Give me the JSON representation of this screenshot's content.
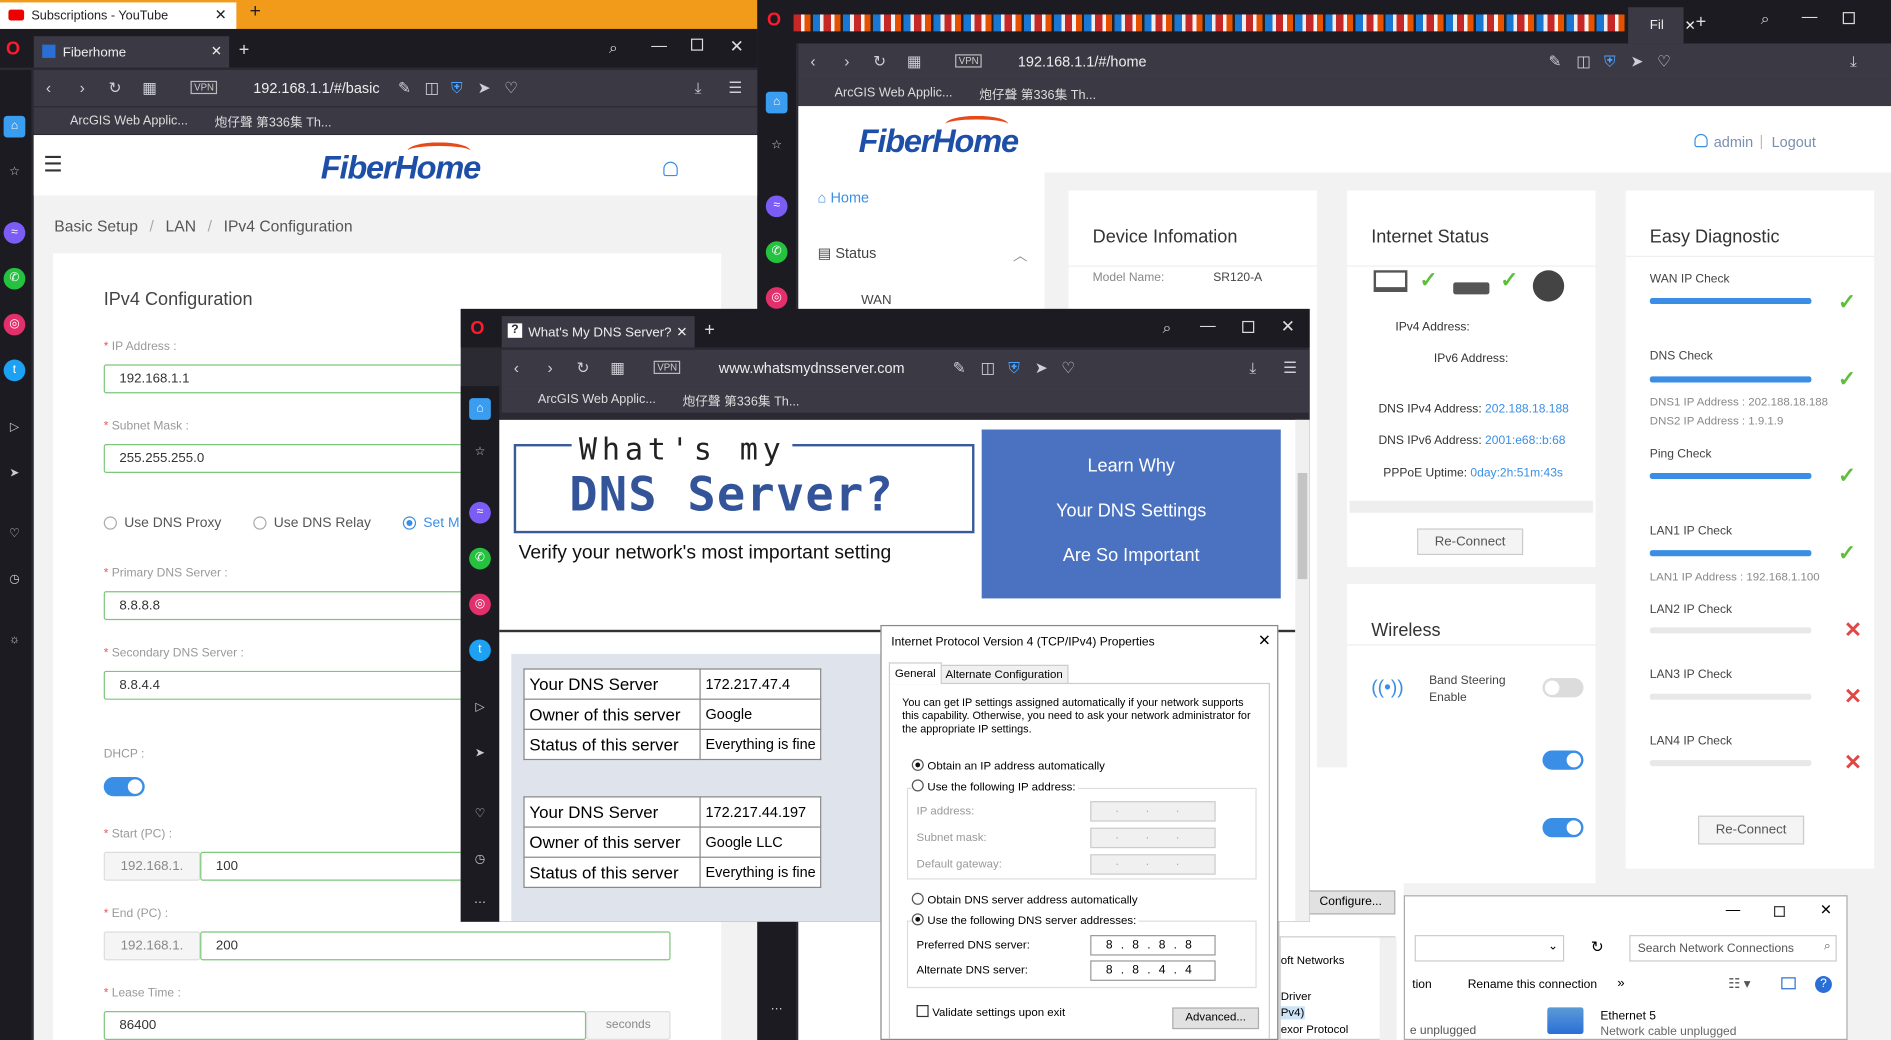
{
  "left_window": {
    "top_strip": {
      "tab_title": "Subscriptions - YouTube"
    },
    "tab_title": "Fiberhome",
    "url": "192.168.1.1/#/basic",
    "bookmarks": [
      "ArcGIS Web Applic...",
      "炮仔聲 第336集 Th..."
    ],
    "logo": "FiberHome",
    "breadcrumb": [
      "Basic Setup",
      "LAN",
      "IPv4 Configuration"
    ],
    "section_title": "IPv4 Configuration",
    "ip_address": {
      "label": "IP Address :",
      "value": "192.168.1.1"
    },
    "subnet_mask": {
      "label": "Subnet Mask :",
      "value": "255.255.255.0"
    },
    "dns_modes": [
      "Use DNS Proxy",
      "Use DNS Relay",
      "Set M"
    ],
    "primary_dns": {
      "label": "Primary DNS Server :",
      "value": "8.8.8.8"
    },
    "secondary_dns": {
      "label": "Secondary DNS Server :",
      "value": "8.8.4.4"
    },
    "dhcp": {
      "label": "DHCP :"
    },
    "start_pc": {
      "label": "Start (PC) :",
      "prefix": "192.168.1.",
      "value": "100"
    },
    "end_pc": {
      "label": "End (PC) :",
      "prefix": "192.168.1.",
      "value": "200"
    },
    "lease_time": {
      "label": "Lease Time :",
      "value": "86400",
      "unit": "seconds"
    }
  },
  "right_window": {
    "tab_title": "Fil",
    "url": "192.168.1.1/#/home",
    "bookmarks": [
      "ArcGIS Web Applic...",
      "炮仔聲 第336集 Th..."
    ],
    "logo": "FiberHome",
    "user": "admin",
    "logout": "Logout",
    "nav": {
      "home": "Home",
      "status": "Status",
      "wan": "WAN"
    },
    "device_info": {
      "title": "Device Infomation",
      "model_label": "Model Name:",
      "model_value": "SR120-A"
    },
    "internet_status": {
      "title": "Internet Status",
      "ipv4_label": "IPv4 Address:",
      "ipv6_label": "IPv6 Address:",
      "dns_ipv4_label": "DNS IPv4 Address:",
      "dns_ipv4_value": "202.188.18.188",
      "dns_ipv6_label": "DNS IPv6 Address:",
      "dns_ipv6_value": "2001:e68::b:68",
      "pppoe_label": "PPPoE Uptime:",
      "pppoe_value": "0day:2h:51m:43s",
      "reconnect": "Re-Connect"
    },
    "wireless": {
      "title": "Wireless",
      "band_steering": "Band Steering Enable"
    },
    "easy_diagnostic": {
      "title": "Easy Diagnostic",
      "checks": [
        {
          "label": "WAN IP Check",
          "status": "ok"
        },
        {
          "label": "DNS Check",
          "status": "ok",
          "sub1": "DNS1 IP Address : 202.188.18.188",
          "sub2": "DNS2 IP Address : 1.9.1.9"
        },
        {
          "label": "Ping Check",
          "status": "ok"
        },
        {
          "label": "LAN1 IP Check",
          "status": "ok",
          "sub1": "LAN1 IP Address : 192.168.1.100"
        },
        {
          "label": "LAN2 IP Check",
          "status": "fail"
        },
        {
          "label": "LAN3 IP Check",
          "status": "fail"
        },
        {
          "label": "LAN4 IP Check",
          "status": "fail"
        }
      ],
      "reconnect": "Re-Connect"
    }
  },
  "dns_window": {
    "tab_title": "What's My DNS Server?",
    "url": "www.whatsmydnsserver.com",
    "bookmarks": [
      "ArcGIS Web Applic...",
      "炮仔聲 第336集 Th..."
    ],
    "logo_top": "What's my",
    "logo_main": "DNS Server?",
    "tagline": "Verify your network's most important setting",
    "learn_why": [
      "Learn Why",
      "Your DNS Settings",
      "Are So Important"
    ],
    "results": [
      {
        "rows": [
          [
            "Your DNS Server",
            "172.217.47.4"
          ],
          [
            "Owner of this server",
            "Google"
          ],
          [
            "Status of this server",
            "Everything is fine"
          ]
        ]
      },
      {
        "rows": [
          [
            "Your DNS Server",
            "172.217.44.197"
          ],
          [
            "Owner of this server",
            "Google LLC"
          ],
          [
            "Status of this server",
            "Everything is fine"
          ]
        ]
      }
    ]
  },
  "ipv4_dialog": {
    "title": "Internet Protocol Version 4 (TCP/IPv4) Properties",
    "tabs": [
      "General",
      "Alternate Configuration"
    ],
    "info": "You can get IP settings assigned automatically if your network supports this capability. Otherwise, you need to ask your network administrator for the appropriate IP settings.",
    "obtain_ip": "Obtain an IP address automatically",
    "use_ip": "Use the following IP address:",
    "ip_address": "IP address:",
    "subnet_mask": "Subnet mask:",
    "default_gateway": "Default gateway:",
    "obtain_dns": "Obtain DNS server address automatically",
    "use_dns": "Use the following DNS server addresses:",
    "preferred_dns": "Preferred DNS server:",
    "preferred_value": "8 . 8 . 8 . 8",
    "alternate_dns": "Alternate DNS server:",
    "alternate_value": "8 . 8 . 4 . 4",
    "validate": "Validate settings upon exit",
    "advanced": "Advanced..."
  },
  "background_dialog": {
    "configure": "Configure...",
    "list_items": [
      "oft Networks",
      "Driver",
      "Pv4)",
      "exor Protocol"
    ]
  },
  "network_connections": {
    "search_placeholder": "Search Network Connections",
    "toolbar": [
      "tion",
      "Rename this connection",
      "»"
    ],
    "items": [
      {
        "name": "Ethernet 5",
        "status": "Network cable unplugged"
      },
      {
        "status": "e unplugged"
      }
    ]
  }
}
